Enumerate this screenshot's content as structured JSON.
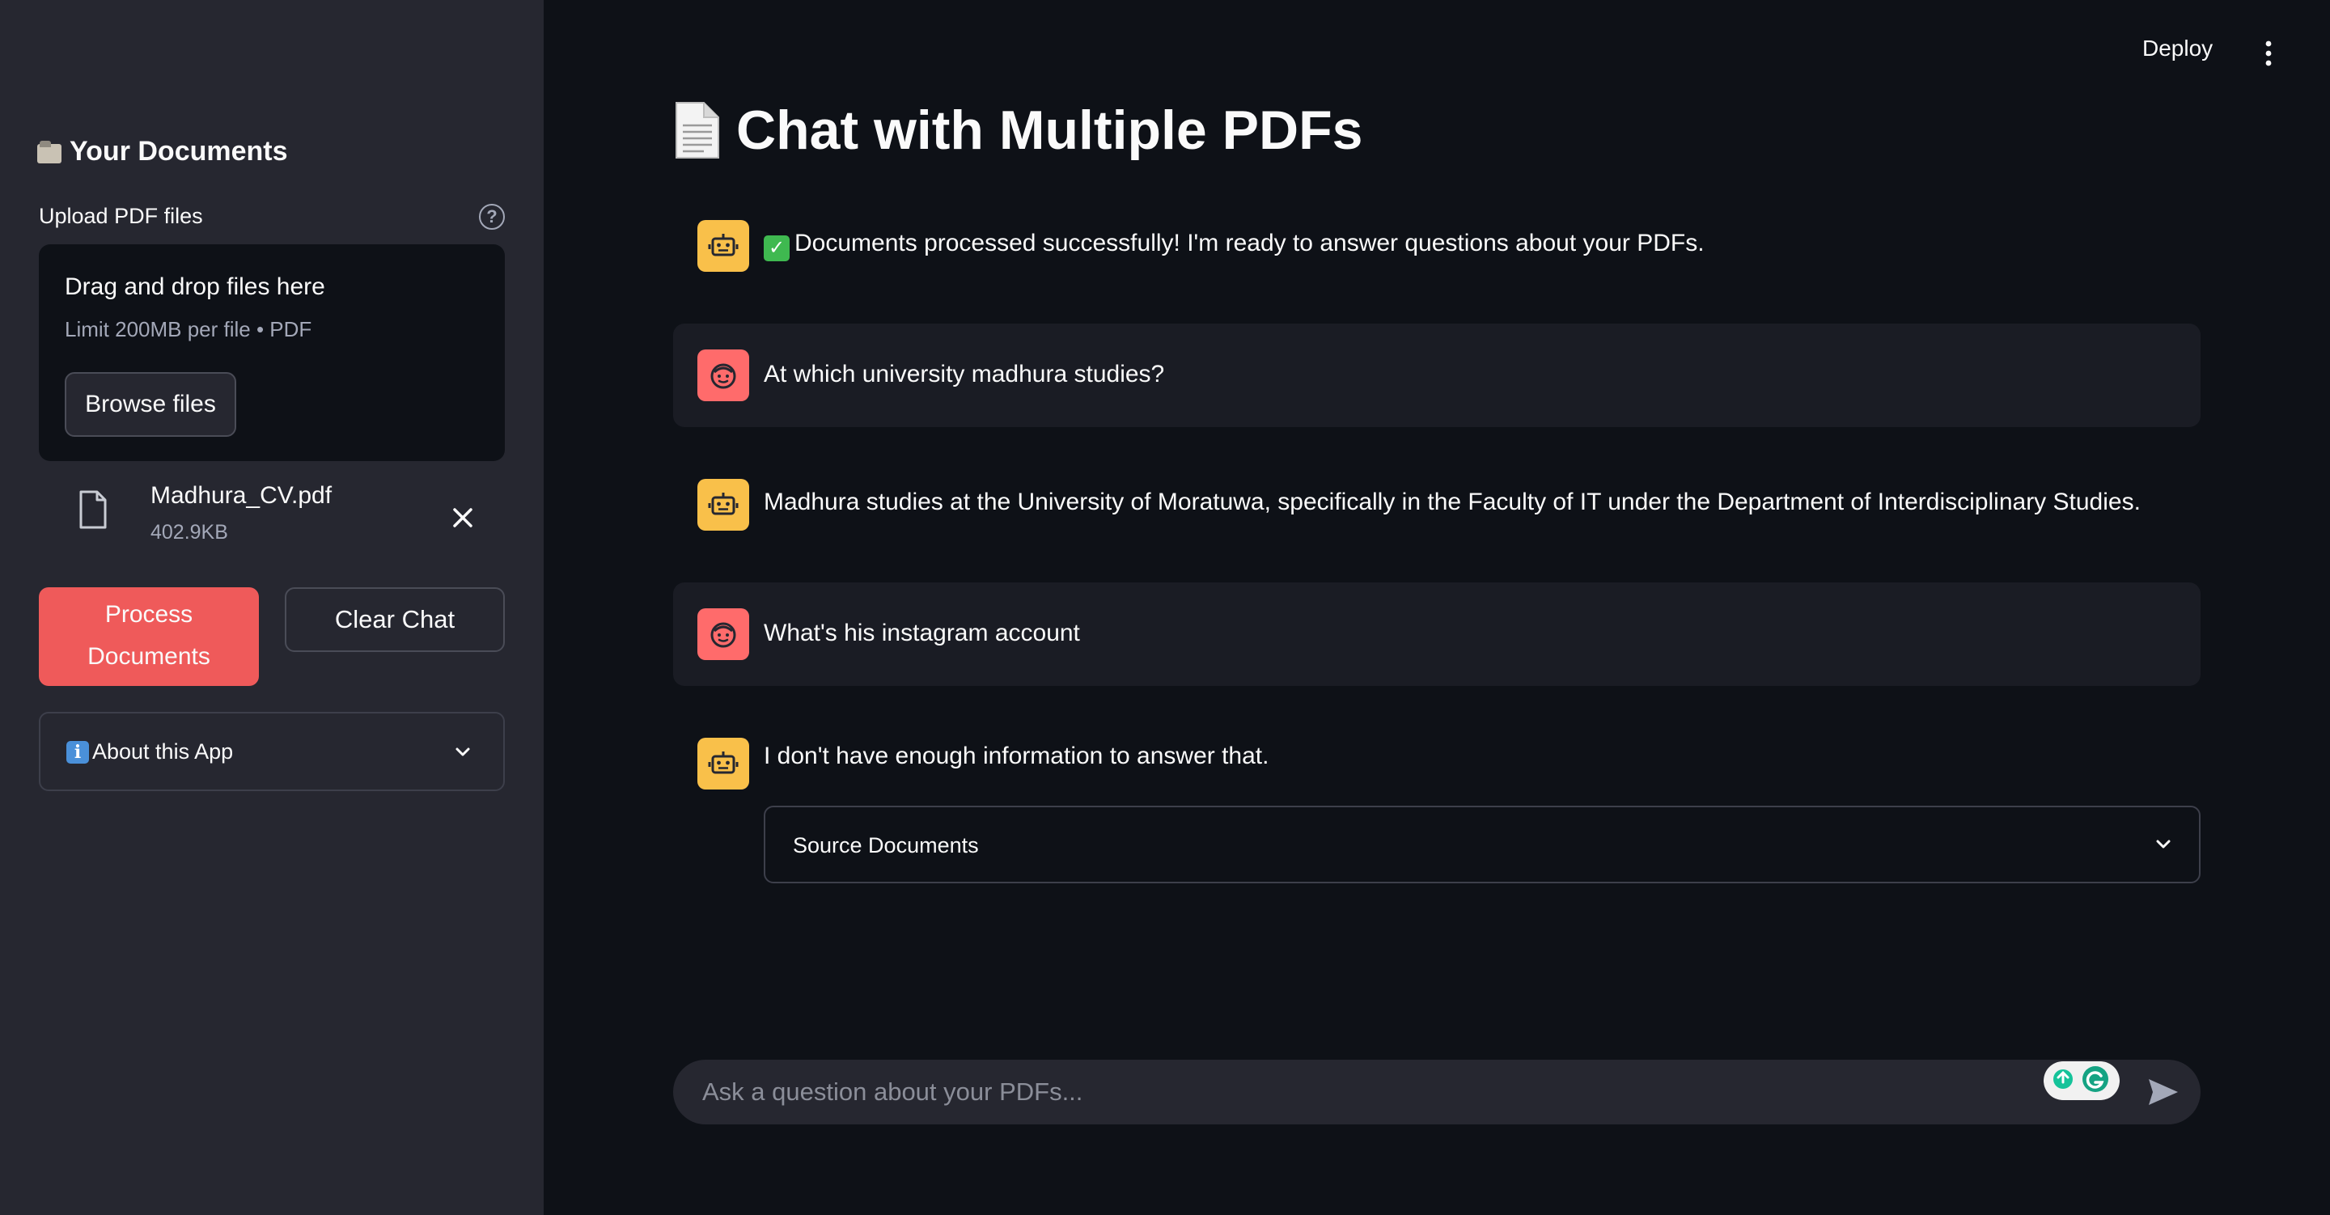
{
  "sidebar": {
    "heading": "Your Documents",
    "upload_label": "Upload PDF files",
    "dropzone": {
      "title": "Drag and drop files here",
      "limit": "Limit 200MB per file • PDF",
      "browse_label": "Browse files"
    },
    "file": {
      "name": "Madhura_CV.pdf",
      "size": "402.9KB"
    },
    "process_label": "Process Documents",
    "clear_label": "Clear Chat",
    "about_label": "About this App"
  },
  "header": {
    "deploy_label": "Deploy"
  },
  "main": {
    "title": "Chat with Multiple PDFs",
    "messages": [
      {
        "role": "assistant",
        "text": "Documents processed successfully! I'm ready to answer questions about your PDFs."
      },
      {
        "role": "user",
        "text": "At which university madhura studies?"
      },
      {
        "role": "assistant",
        "text": "Madhura studies at the University of Moratuwa, specifically in the Faculty of IT under the Department of Interdisciplinary Studies."
      },
      {
        "role": "user",
        "text": "What's his instagram account"
      },
      {
        "role": "assistant",
        "text": "I don't have enough information to answer that."
      }
    ],
    "source_documents_label": "Source Documents",
    "chat_input": {
      "placeholder": "Ask a question about your PDFs...",
      "value": ""
    }
  },
  "colors": {
    "background": "#0e1117",
    "sidebar": "#262730",
    "primary_button": "#ef5a5a",
    "assistant_avatar": "#f9c04a",
    "user_avatar": "#ff6b6b"
  },
  "icons": [
    "folder-icon",
    "help-icon",
    "file-icon",
    "close-icon",
    "chevron-down-icon",
    "info-icon",
    "document-icon",
    "robot-icon",
    "user-face-icon",
    "check-icon",
    "send-icon",
    "more-vertical-icon",
    "grammarly-icon"
  ]
}
